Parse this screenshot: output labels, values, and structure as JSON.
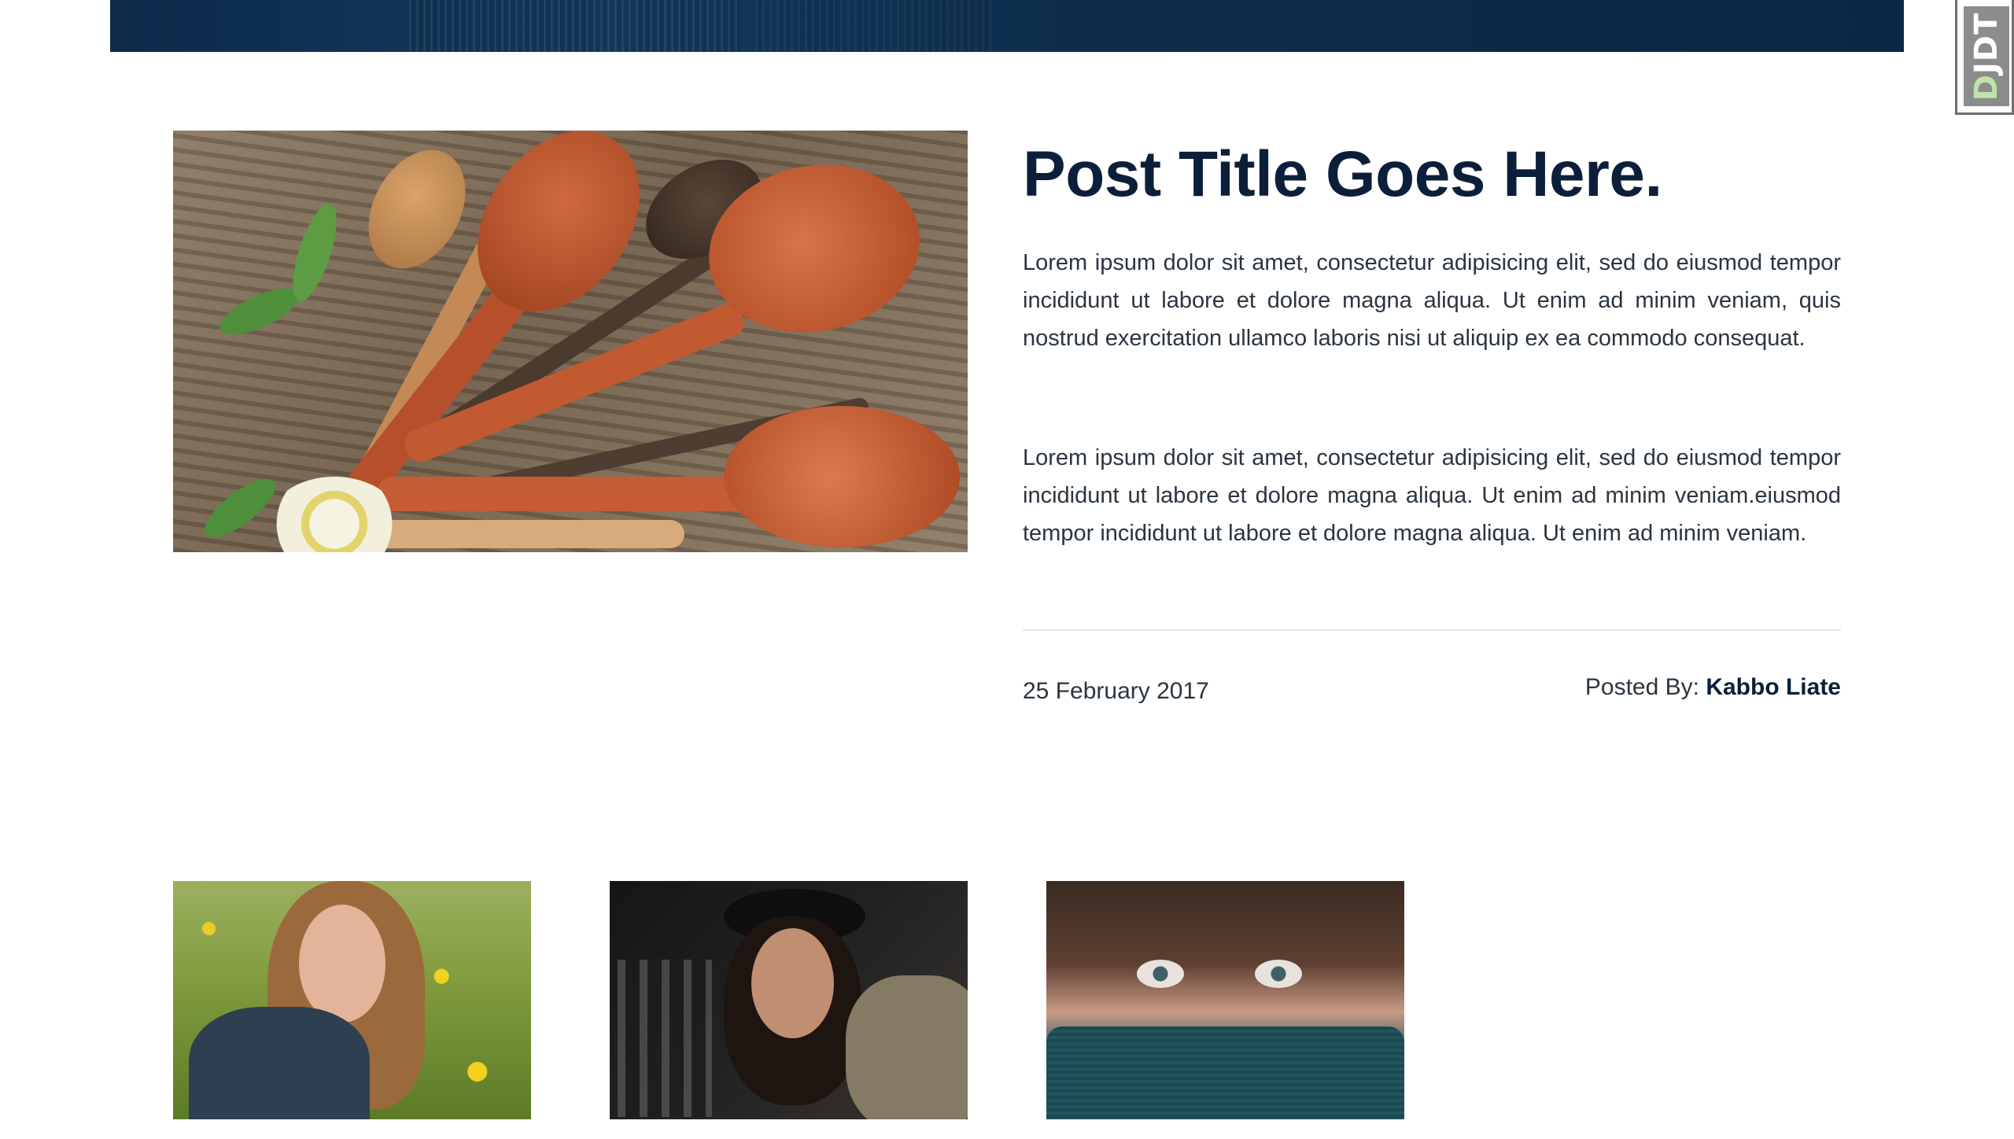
{
  "post": {
    "title": "Post Title Goes Here.",
    "paragraphs": [
      "Lorem ipsum dolor sit amet, consectetur adipisicing elit, sed do eiusmod tempor incididunt ut labore et dolore magna aliqua. Ut enim ad minim veniam, quis nostrud exercitation ullamco laboris nisi ut aliquip ex ea commodo consequat.",
      "Lorem ipsum dolor sit amet, consectetur adipisicing elit, sed do eiusmod tempor incididunt ut labore et dolore magna aliqua. Ut enim ad minim veniam.eiusmod tempor incididunt ut labore et dolore magna aliqua. Ut enim ad minim veniam."
    ],
    "date": "25 February 2017",
    "posted_by_label": "Posted By:",
    "author": "Kabbo Liate"
  },
  "badge": {
    "letter_d": "D",
    "letters_rest": "JDT"
  },
  "colors": {
    "title": "#0c1f3a",
    "hero": "#0c2a4a",
    "text": "#2a3540"
  },
  "icons": {
    "post_image": "wooden-spoons-image",
    "gallery": [
      "woman-in-flowers-image",
      "smiling-woman-hat-image",
      "woman-eyes-scarf-image"
    ]
  }
}
